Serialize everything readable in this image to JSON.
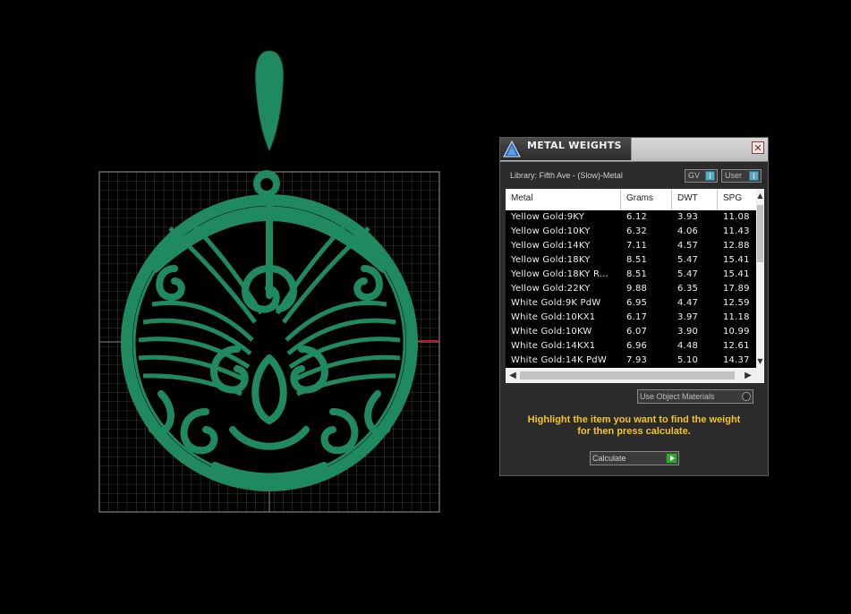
{
  "panel": {
    "title": "METAL WEIGHTS",
    "close_glyph": "✕",
    "library_label": "Library: Fifth Ave - (Slow)-Metal",
    "gv_label": "GV",
    "user_label": "User",
    "use_object_materials_label": "Use Object Materials",
    "hint_line1": "Highlight the item you want to find the weight",
    "hint_line2": "for then press calculate.",
    "calculate_label": "Calculate"
  },
  "table": {
    "columns": [
      "Metal",
      "Grams",
      "DWT",
      "SPG"
    ],
    "rows": [
      [
        "Yellow Gold:9KY",
        "6.12",
        "3.93",
        "11.08"
      ],
      [
        "Yellow Gold:10KY",
        "6.32",
        "4.06",
        "11.43"
      ],
      [
        "Yellow Gold:14KY",
        "7.11",
        "4.57",
        "12.88"
      ],
      [
        "Yellow Gold:18KY",
        "8.51",
        "5.47",
        "15.41"
      ],
      [
        "Yellow Gold:18KY R...",
        "8.51",
        "5.47",
        "15.41"
      ],
      [
        "Yellow Gold:22KY",
        "9.88",
        "6.35",
        "17.89"
      ],
      [
        "White Gold:9K PdW",
        "6.95",
        "4.47",
        "12.59"
      ],
      [
        "White Gold:10KX1",
        "6.17",
        "3.97",
        "11.18"
      ],
      [
        "White Gold:10KW",
        "6.07",
        "3.90",
        "10.99"
      ],
      [
        "White Gold:14KX1",
        "6.96",
        "4.48",
        "12.61"
      ],
      [
        "White Gold:14K PdW",
        "7.93",
        "5.10",
        "14.37"
      ]
    ]
  },
  "colors": {
    "model_green": "#1f8a5f",
    "grid_line": "#7a7a7a",
    "hint_yellow": "#f2c42a",
    "axis_red": "#c0182a"
  },
  "icons": {
    "app": "triangle-logo-icon",
    "close": "close-icon",
    "calculate": "play-icon"
  }
}
